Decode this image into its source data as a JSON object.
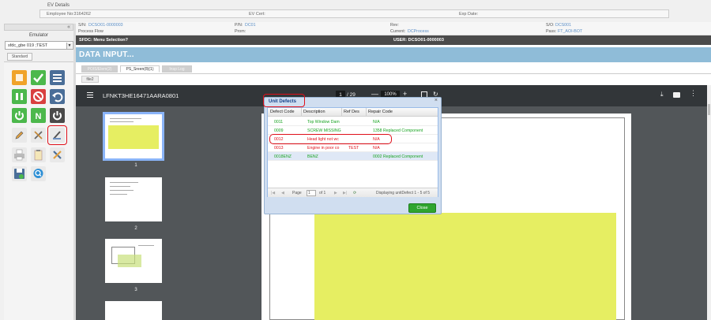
{
  "ev": {
    "title": "EV Details",
    "employee": "Employee No:3164262",
    "cert": "EV Cert:",
    "exp": "Exp Date:"
  },
  "emulator": {
    "collapse": "«",
    "title": "Emulator",
    "select_value": "sfdc_gbe 019 ;TEST",
    "tab": "Standard"
  },
  "info": {
    "sn_label": "S/N:",
    "sn_value": "DCSO01-0000003",
    "process_flow": "Process Flow",
    "pn_label": "P/N:",
    "pn_value": "DC01",
    "prom": "Prom:",
    "rev": "Rev:",
    "current_label": "Current:",
    "current_value": "DCProcess",
    "so_label": "S/O:",
    "so_value": "DCS001",
    "pass_label": "Pass:",
    "pass_value": "FT_AOI-BOT"
  },
  "sfdc_bar": {
    "left": "SFDC: Menu Selection?",
    "right": "USER: DCSO01-0000003"
  },
  "data_input_title": "DATA INPUT...",
  "tabs": [
    "POIS/Elem(2)",
    "PS_Sreen(8)(1)",
    "Insp Log"
  ],
  "subtab": "file2",
  "viewer": {
    "title": "LFNKT3HE16471AARA0801",
    "page": "1",
    "of": "/ 29",
    "zoom": "100%",
    "thumb_labels": [
      "1",
      "2",
      "3"
    ]
  },
  "dialog": {
    "title": "Unit Defects",
    "close": "×",
    "columns": [
      "Defect Code",
      "Description",
      "Ref Des",
      "Repair Code"
    ],
    "rows": [
      {
        "code": "0011",
        "desc": "Top Window Dam",
        "ref": "",
        "repair": "N/A",
        "color": "green"
      },
      {
        "code": "0009",
        "desc": "SCREW MISSING",
        "ref": "",
        "repair": "1358 Replaced Component",
        "color": "green"
      },
      {
        "code": "0012",
        "desc": "Head light not wc",
        "ref": "",
        "repair": "N/A",
        "color": "red"
      },
      {
        "code": "0013",
        "desc": "Engine in poor co",
        "ref": "TEST",
        "repair": "N/A",
        "color": "red"
      },
      {
        "code": "0018ENZ",
        "desc": "BENZ",
        "ref": "",
        "repair": "0002 Replaced Component",
        "color": "green"
      }
    ],
    "pager_page_label": "Page",
    "pager_page_value": "1",
    "pager_of": "of 1",
    "pager_display": "Displaying unitDefect 1 - 5 of 5",
    "close_button": "Close"
  },
  "colors": {
    "accent_blue": "#8fbcd8",
    "dark_bar": "#4b4b4b",
    "green": "#18a321",
    "red": "#e0101a",
    "yellow": "#e6ee62"
  }
}
